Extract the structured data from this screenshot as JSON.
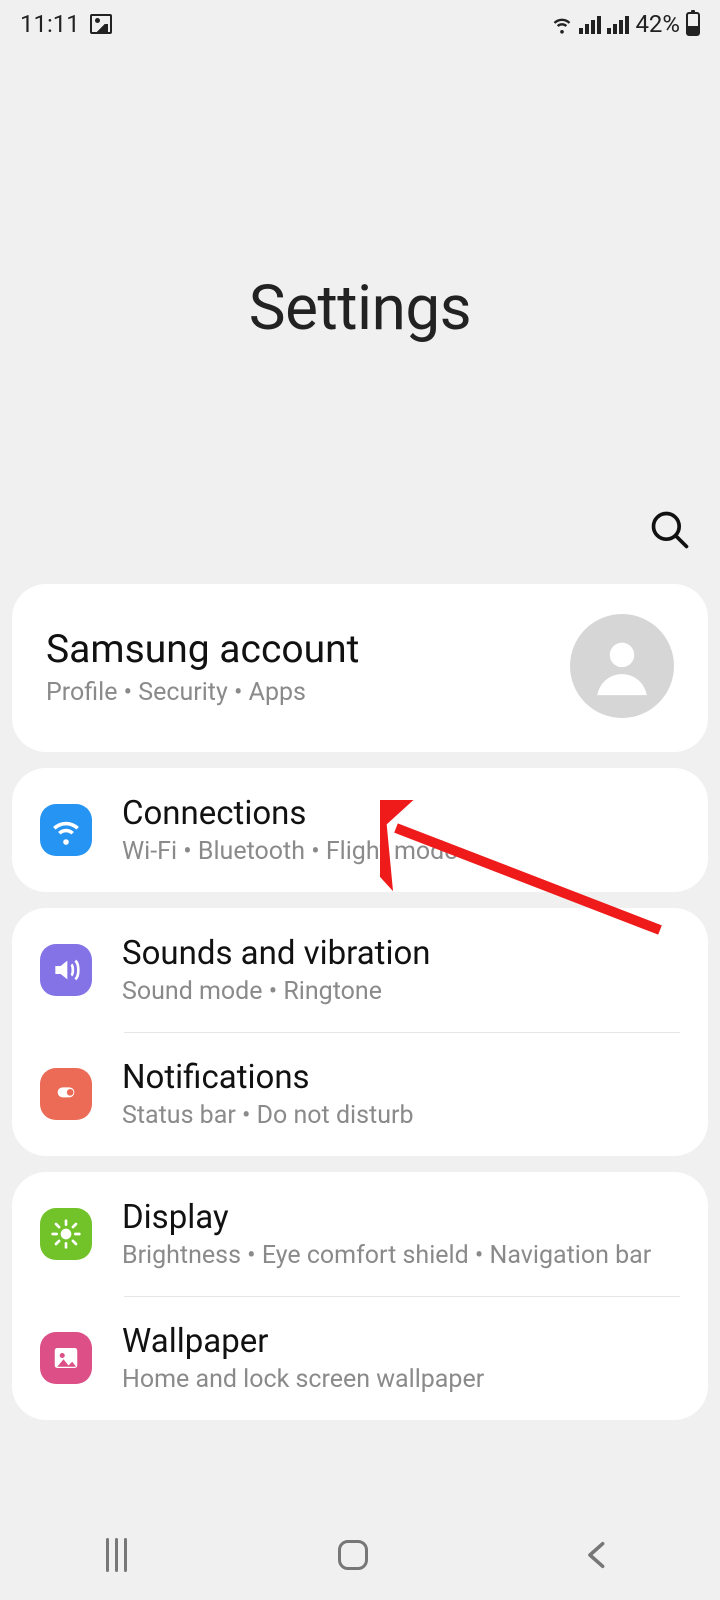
{
  "status": {
    "time": "11:11",
    "battery": "42%"
  },
  "hero": {
    "title": "Settings"
  },
  "account": {
    "title": "Samsung account",
    "subtitle": "Profile  •  Security  •  Apps"
  },
  "groups": [
    {
      "items": [
        {
          "key": "connections",
          "title": "Connections",
          "subtitle": "Wi-Fi  •  Bluetooth  •  Flight mode",
          "iconClass": "ic-blue",
          "iconName": "wifi-icon"
        }
      ]
    },
    {
      "items": [
        {
          "key": "sounds",
          "title": "Sounds and vibration",
          "subtitle": "Sound mode  •  Ringtone",
          "iconClass": "ic-purple",
          "iconName": "speaker-icon"
        },
        {
          "key": "notifications",
          "title": "Notifications",
          "subtitle": "Status bar  •  Do not disturb",
          "iconClass": "ic-coral",
          "iconName": "toggle-icon"
        }
      ]
    },
    {
      "items": [
        {
          "key": "display",
          "title": "Display",
          "subtitle": "Brightness  •  Eye comfort shield  •  Navigation bar",
          "iconClass": "ic-green",
          "iconName": "sun-icon"
        },
        {
          "key": "wallpaper",
          "title": "Wallpaper",
          "subtitle": "Home and lock screen wallpaper",
          "iconClass": "ic-pink",
          "iconName": "image-icon"
        }
      ]
    }
  ],
  "annotation": {
    "target": "connections"
  }
}
